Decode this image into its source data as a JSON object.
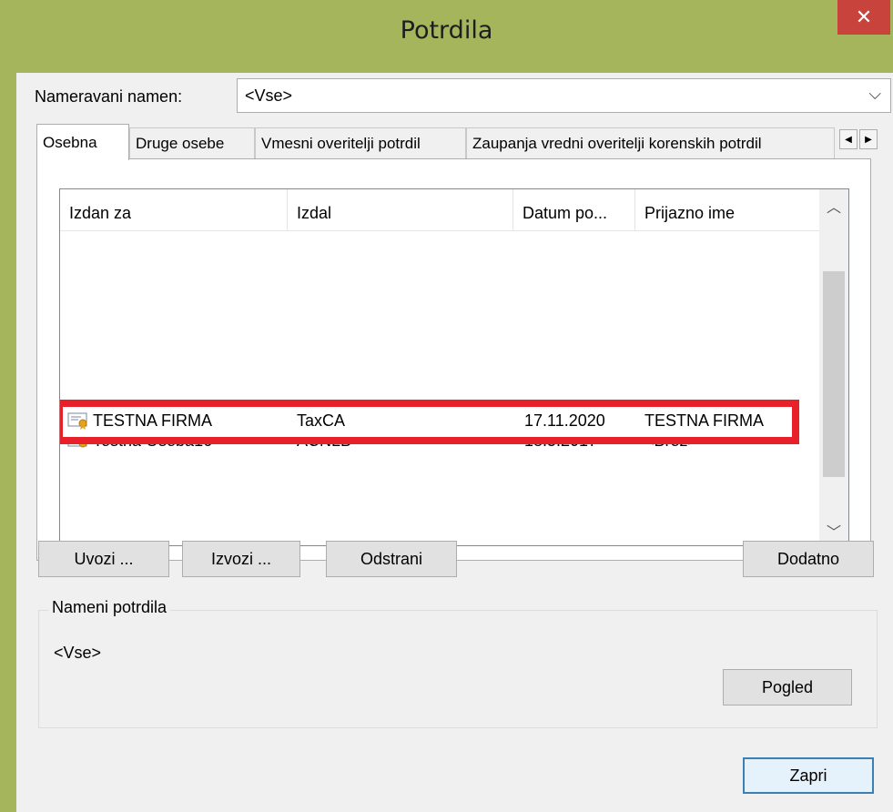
{
  "window": {
    "title": "Potrdila",
    "close_glyph": "✕",
    "accent_color": "#a4b55c"
  },
  "purpose": {
    "label": "Nameravani namen:",
    "value": "<Vse>"
  },
  "tabs": [
    {
      "label": "Osebna",
      "active": true
    },
    {
      "label": "Druge osebe",
      "active": false
    },
    {
      "label": "Vmesni overitelji potrdil",
      "active": false
    },
    {
      "label": "Zaupanja vredni overitelji korenskih potrdil",
      "active": false
    }
  ],
  "list": {
    "columns": [
      "Izdan za",
      "Izdal",
      "Datum po...",
      "Prijazno ime"
    ],
    "rows": [
      {
        "issued_to": "TESTNA FIRMA",
        "issued_by": "TaxCA",
        "expires": "17.11.2020",
        "friendly_name": "TESTNA FIRMA",
        "highlighted": true
      },
      {
        "issued_to": "Testna Oseba16",
        "issued_by": "ACNLB",
        "expires": "18.5.2017",
        "friendly_name": "<Brez>",
        "highlighted": false
      }
    ],
    "highlight_color": "#e8202a"
  },
  "buttons": {
    "import": "Uvozi ...",
    "export": "Izvozi ...",
    "remove": "Odstrani",
    "advanced": "Dodatno",
    "view": "Pogled",
    "close": "Zapri"
  },
  "purposes_group": {
    "label": "Nameni potrdila",
    "value": "<Vse>"
  }
}
